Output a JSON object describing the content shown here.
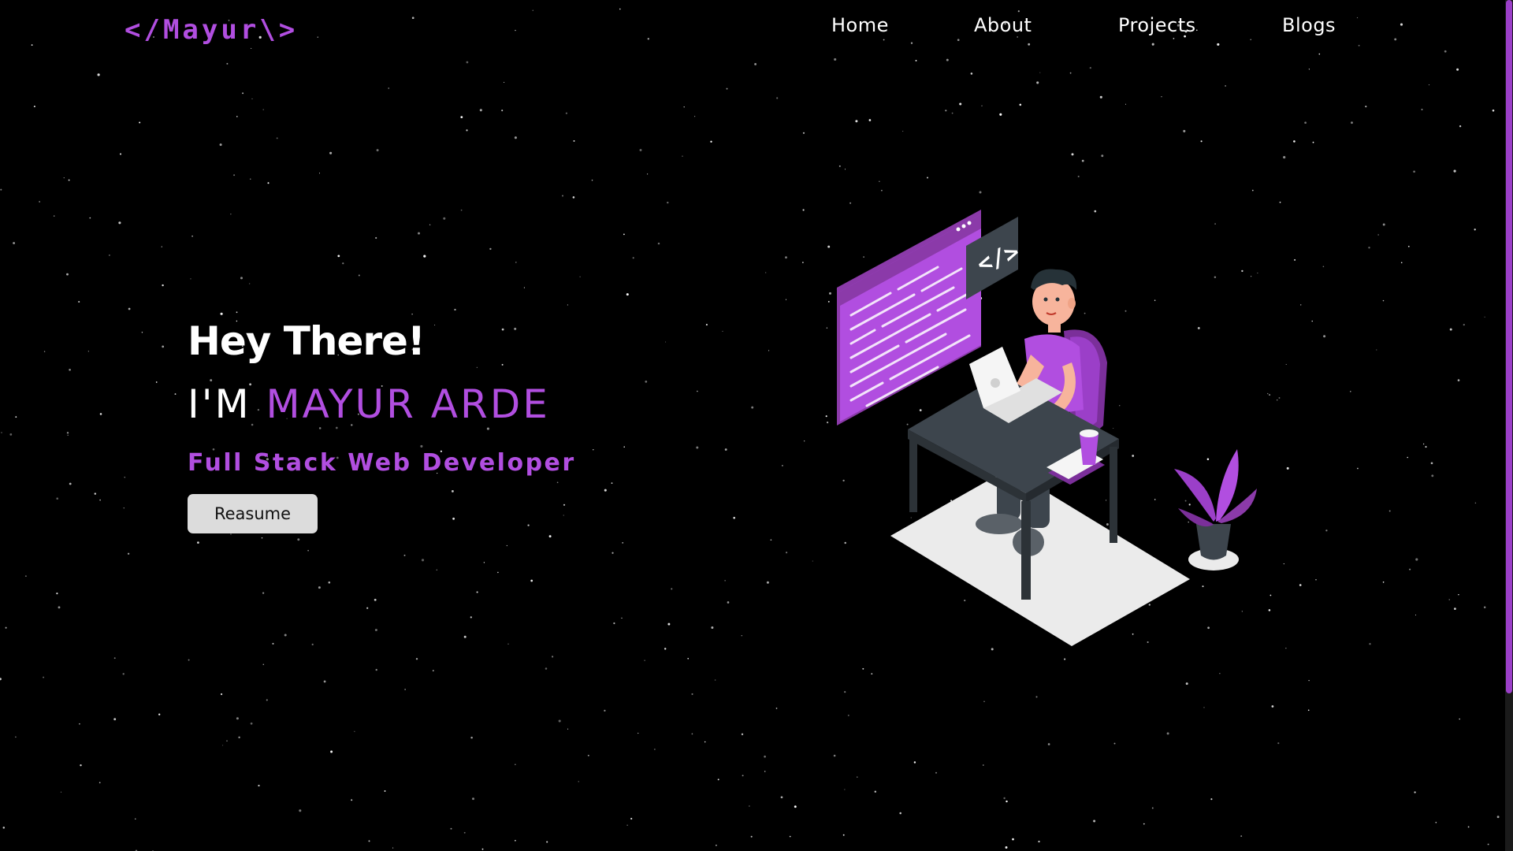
{
  "logo": {
    "text": "</Mayur\\>"
  },
  "nav": {
    "items": [
      {
        "label": "Home"
      },
      {
        "label": "About"
      },
      {
        "label": "Projects"
      },
      {
        "label": "Blogs"
      }
    ]
  },
  "hero": {
    "greeting": "Hey There!",
    "intro_prefix": "I'M",
    "name": "MAYUR ARDE",
    "role": "Full Stack Web Developer",
    "resume_label": "Reasume"
  },
  "illustration": {
    "code_badge": "</>"
  },
  "colors": {
    "background": "#000000",
    "accent": "#b14ee0",
    "text": "#ffffff",
    "button_bg": "#dcdcdc",
    "scroll_thumb": "#9b3fc8"
  },
  "icons": {
    "illustration": "developer-at-desk-illustration",
    "background": "starfield"
  }
}
